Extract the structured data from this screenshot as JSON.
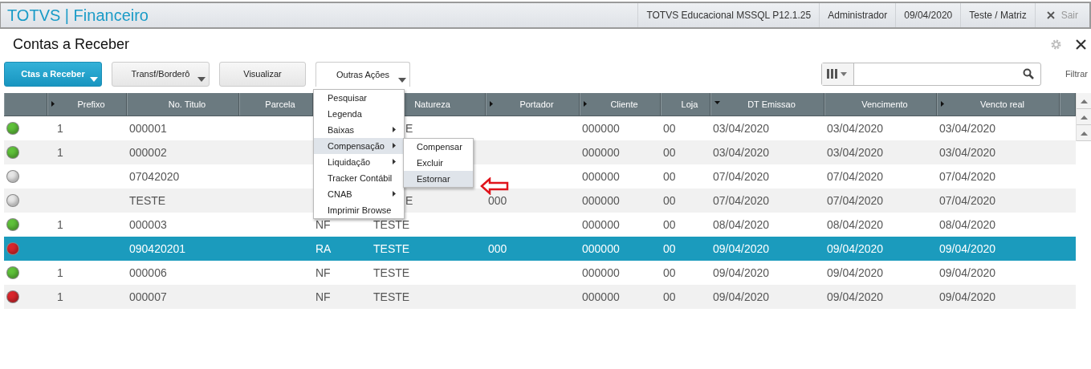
{
  "top_bar": {
    "app_title": "TOTVS | Financeiro",
    "items": [
      "TOTVS Educacional MSSQL P12.1.25",
      "Administrador",
      "09/04/2020",
      "Teste / Matriz"
    ],
    "exit_label": "Sair"
  },
  "page": {
    "title": "Contas a Receber"
  },
  "toolbar": {
    "buttons": [
      {
        "label": "Ctas a Receber",
        "kind": "primary",
        "dropdown": true
      },
      {
        "label": "Transf/Borderô",
        "kind": "plain",
        "dropdown": true
      },
      {
        "label": "Visualizar",
        "kind": "plain",
        "dropdown": false
      },
      {
        "label": "Outras Ações",
        "kind": "open",
        "dropdown": true
      }
    ],
    "filter_label": "Filtrar"
  },
  "menu": {
    "items": [
      {
        "label": "Pesquisar",
        "submenu": false,
        "selected": false
      },
      {
        "label": "Legenda",
        "submenu": false,
        "selected": false
      },
      {
        "label": "Baixas",
        "submenu": true,
        "selected": false
      },
      {
        "label": "Compensação",
        "submenu": true,
        "selected": true
      },
      {
        "label": "Liquidação",
        "submenu": true,
        "selected": false
      },
      {
        "label": "Tracker Contábil",
        "submenu": false,
        "selected": false
      },
      {
        "label": "CNAB",
        "submenu": true,
        "selected": false
      },
      {
        "label": "Imprimir Browse",
        "submenu": false,
        "selected": false
      }
    ],
    "submenu": [
      {
        "label": "Compensar",
        "selected": false
      },
      {
        "label": "Excluir",
        "selected": false
      },
      {
        "label": "Estornar",
        "selected": true
      }
    ]
  },
  "table": {
    "columns": [
      {
        "kind": "status"
      },
      {
        "label": "Prefixo",
        "kind": "expandable"
      },
      {
        "label": "No. Titulo",
        "kind": "plain"
      },
      {
        "label": "Parcela",
        "kind": "plain"
      },
      {
        "kind": "plain"
      },
      {
        "label": "Natureza",
        "kind": "plain"
      },
      {
        "label": "Portador",
        "kind": "expandable"
      },
      {
        "label": "Cliente",
        "kind": "expandable"
      },
      {
        "label": "Loja",
        "kind": "plain"
      },
      {
        "label": "DT Emissao",
        "kind": "sorted"
      },
      {
        "label": "Vencimento",
        "kind": "plain"
      },
      {
        "label": "Vencto real",
        "kind": "expandable"
      }
    ],
    "rows": [
      {
        "color": "#5fc13a",
        "selected": false,
        "cells": [
          "1",
          "000001",
          null,
          null,
          {
            "text": "E",
            "covered": true
          },
          null,
          "000000",
          "00",
          "03/04/2020",
          "03/04/2020",
          "03/04/2020"
        ]
      },
      {
        "color": "#5fc13a",
        "selected": false,
        "cells": [
          "1",
          "000002",
          null,
          null,
          null,
          null,
          "000000",
          "00",
          "03/04/2020",
          "03/04/2020",
          "03/04/2020"
        ]
      },
      {
        "color": "#e6e6e6",
        "selected": false,
        "cells": [
          null,
          "07042020",
          null,
          null,
          null,
          null,
          "000000",
          "00",
          "07/04/2020",
          "07/04/2020",
          "07/04/2020"
        ]
      },
      {
        "color": "#e6e6e6",
        "selected": false,
        "cells": [
          null,
          "TESTE",
          null,
          null,
          {
            "text": "E",
            "covered": true
          },
          "000",
          "000000",
          "00",
          "07/04/2020",
          "07/04/2020",
          "07/04/2020"
        ]
      },
      {
        "color": "#5fc13a",
        "selected": false,
        "cells": [
          "1",
          "000003",
          null,
          "NF",
          "TESTE",
          null,
          "000000",
          "00",
          "08/04/2020",
          "08/04/2020",
          "08/04/2020"
        ]
      },
      {
        "color": "#d9262c",
        "selected": true,
        "cells": [
          null,
          "090420201",
          null,
          "RA",
          "TESTE",
          "000",
          "000000",
          "00",
          "09/04/2020",
          "09/04/2020",
          "09/04/2020"
        ]
      },
      {
        "color": "#5fc13a",
        "selected": false,
        "cells": [
          "1",
          "000006",
          null,
          "NF",
          "TESTE",
          null,
          "000000",
          "00",
          "09/04/2020",
          "09/04/2020",
          "09/04/2020"
        ]
      },
      {
        "color": "#d9262c",
        "selected": false,
        "cells": [
          "1",
          "000007",
          null,
          "NF",
          "TESTE",
          null,
          "000000",
          "00",
          "09/04/2020",
          "09/04/2020",
          "09/04/2020"
        ]
      }
    ]
  }
}
